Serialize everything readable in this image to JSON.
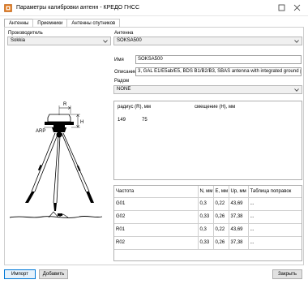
{
  "window": {
    "title": "Параметры калибровки антенн - КРЕДО ГНСС"
  },
  "tabs": [
    {
      "label": "Антенны",
      "active": true
    },
    {
      "label": "Приемники",
      "active": false
    },
    {
      "label": "Антенны спутников",
      "active": false
    }
  ],
  "manufacturer": {
    "label": "Производитель",
    "value": "Sokkia"
  },
  "antenna": {
    "label": "Антенна",
    "value": "SOKSA500"
  },
  "name_field": {
    "label": "Имя",
    "value": "SOKSA500"
  },
  "description_field": {
    "label": "Описание",
    "value": "3, GAL E1/E5ab/E5, BDS B1/B2/B3, SBAS antenna with integrated ground plane,"
  },
  "radome": {
    "label": "Радом",
    "value": "NONE"
  },
  "drawing": {
    "r_label": "R",
    "h_label": "H",
    "arp_label": "ARP"
  },
  "radius_table": {
    "col_radius": "радиус (R), мм",
    "col_offset": "смещение (H), мм",
    "radius_value": "149",
    "offset_value": "75"
  },
  "freq_table": {
    "headers": [
      "Частота",
      "N, мм",
      "E, мм",
      "Up, мм",
      "Таблица поправок"
    ],
    "rows": [
      [
        "G01",
        "0,3",
        "0,22",
        "43,69",
        "..."
      ],
      [
        "G02",
        "0,33",
        "0,26",
        "37,38",
        "..."
      ],
      [
        "R01",
        "0,3",
        "0,22",
        "43,69",
        "..."
      ],
      [
        "R02",
        "0,33",
        "0,26",
        "37,38",
        "..."
      ]
    ]
  },
  "buttons": {
    "import": "Импорт",
    "add": "Добавить",
    "close": "Закрыть"
  },
  "colors": {
    "accent": "#0078d7",
    "app_icon": "#e07a1f"
  }
}
